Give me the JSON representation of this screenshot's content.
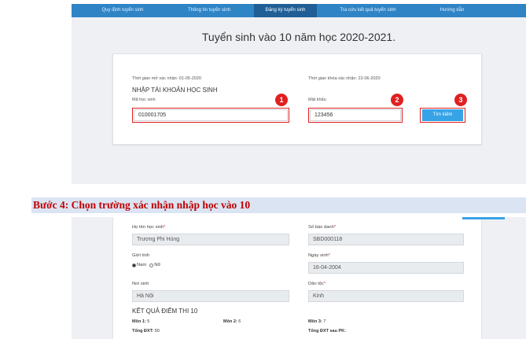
{
  "nav": {
    "items": [
      {
        "label": "Quy định tuyển sinh",
        "active": false
      },
      {
        "label": "Thông tin tuyển sinh",
        "active": false
      },
      {
        "label": "Đăng ký tuyển sinh",
        "active": true
      },
      {
        "label": "Tra cứu kết quả tuyển sinh",
        "active": false
      },
      {
        "label": "Hướng dẫn",
        "active": false
      }
    ]
  },
  "page_title": "Tuyển sinh vào 10 năm học 2020-2021.",
  "login": {
    "open_time": "Thời gian mở xác nhận: 01-05-2020",
    "close_time": "Thời gian khóa xác nhận: 22-06-2020",
    "heading": "NHẬP TÀI KHOẢN HỌC SINH",
    "student_id_label": "Mã học sinh",
    "student_id_value": "010001705",
    "password_label": "Mật khẩu",
    "password_value": "123456",
    "search_button": "Tìm kiếm",
    "markers": [
      "1",
      "2",
      "3"
    ]
  },
  "step_heading": "Bước 4: Chọn trường xác nhận nhập học vào 10",
  "student": {
    "name_label": "Họ tên học sinh",
    "name_value": "Trương Phi Hùng",
    "sbd_label": "Số báo danh",
    "sbd_value": "SBD000118",
    "gender_label": "Giới tính",
    "gender_options": [
      "Nam",
      "Nữ"
    ],
    "gender_selected": "Nam",
    "dob_label": "Ngày sinh",
    "dob_value": "16-04-2004",
    "birthplace_label": "Nơi sinh",
    "birthplace_value": "Hà Nội",
    "ethnicity_label": "Dân tộc",
    "ethnicity_value": "Kinh",
    "required_mark": "*"
  },
  "results": {
    "heading": "KẾT QUẢ ĐIỂM THI 10",
    "mon1_label": "Môn 1:",
    "mon1_value": "5",
    "mon2_label": "Môn 2:",
    "mon2_value": "6",
    "mon3_label": "Môn 3:",
    "mon3_value": "7",
    "total_label": "Tổng ĐXT:",
    "total_value": "50",
    "total_pk_label": "Tổng ĐXT sau PK:",
    "total_pk_value": ""
  },
  "colors": {
    "nav_bg": "#2f84c6",
    "nav_active": "#1f5f96",
    "button": "#36a3e6",
    "highlight_red": "#e02020",
    "step_text": "#c00000",
    "step_bg": "#dbe4f3"
  }
}
